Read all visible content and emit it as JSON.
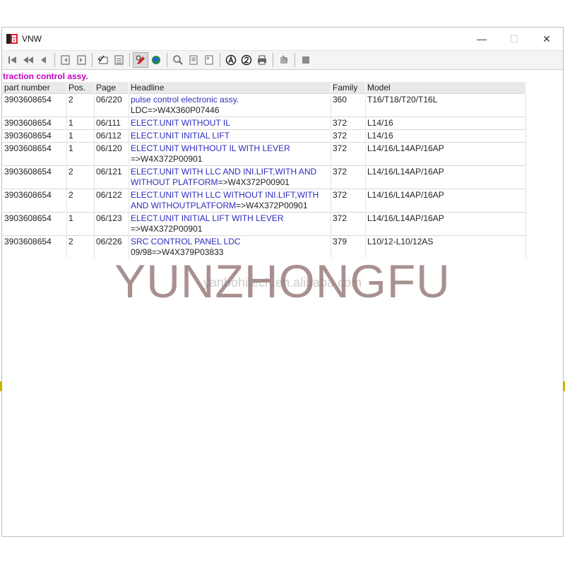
{
  "window": {
    "title": "VNW",
    "min_symbol": "—",
    "max_symbol": "☐",
    "close_symbol": "✕"
  },
  "toolbar": {
    "buttons": [
      {
        "icon": "first-page-icon"
      },
      {
        "icon": "rewind-icon"
      },
      {
        "icon": "previous-icon"
      },
      {
        "icon": "back-book-icon"
      },
      {
        "icon": "forward-book-icon"
      },
      {
        "icon": "list-check-icon"
      },
      {
        "icon": "checklist-icon"
      },
      {
        "icon": "pen-tool-icon"
      },
      {
        "icon": "globe-icon"
      },
      {
        "icon": "zoom-icon"
      },
      {
        "icon": "page-icon"
      },
      {
        "icon": "page-fit-icon"
      },
      {
        "icon": "circle-a-icon"
      },
      {
        "icon": "circle-2-icon"
      },
      {
        "icon": "printer-icon"
      },
      {
        "icon": "annotate-icon"
      },
      {
        "icon": "stop-icon"
      }
    ]
  },
  "section_title": "traction control assy.",
  "table": {
    "headers": [
      "part number",
      "Pos.",
      "Page",
      "Headline",
      "Family",
      "Model"
    ],
    "rows": [
      {
        "part": "3903608654",
        "pos": "2",
        "page": "06/220",
        "headline": "pulse control electronic assy.",
        "note": "LDC=>W4X360P07446",
        "family": "360",
        "model": "T16/T18/T20/T16L"
      },
      {
        "part": "3903608654",
        "pos": "1",
        "page": "06/111",
        "headline": "ELECT.UNIT WITHOUT IL",
        "note": "",
        "family": "372",
        "model": "L14/16"
      },
      {
        "part": "3903608654",
        "pos": "1",
        "page": "06/112",
        "headline": "ELECT.UNIT INITIAL LIFT",
        "note": "",
        "family": "372",
        "model": "L14/16"
      },
      {
        "part": "3903608654",
        "pos": "1",
        "page": "06/120",
        "headline": "ELECT.UNIT WHITHOUT IL WITH LEVER",
        "note": "=>W4X372P00901",
        "family": "372",
        "model": "L14/16/L14AP/16AP"
      },
      {
        "part": "3903608654",
        "pos": "2",
        "page": "06/121",
        "headline": "ELECT.UNIT WITH LLC AND INI.LIFT,WITH AND",
        "headline2": "WITHOUT PLATFORM",
        "note": "=>W4X372P00901",
        "family": "372",
        "model": "L14/16/L14AP/16AP"
      },
      {
        "part": "3903608654",
        "pos": "2",
        "page": "06/122",
        "headline": "ELECT.UNIT WITH LLC WITHOUT INI.LIFT,WITH",
        "headline2": "AND WITHOUTPLATFORM",
        "note": "=>W4X372P00901",
        "family": "372",
        "model": "L14/16/L14AP/16AP"
      },
      {
        "part": "3903608654",
        "pos": "1",
        "page": "06/123",
        "headline": "ELECT.UNIT INITIAL LIFT WITH LEVER",
        "note": "=>W4X372P00901",
        "family": "372",
        "model": "L14/16/L14AP/16AP"
      },
      {
        "part": "3903608654",
        "pos": "2",
        "page": "06/226",
        "headline": "SRC CONTROL PANEL LDC",
        "note": "09/98=>W4X379P03833",
        "family": "379",
        "model": "L10/12-L10/12AS"
      }
    ]
  },
  "watermark": {
    "main": "YUNZHONGFU",
    "sub": "yanbohitech.en.alibaba.com"
  }
}
